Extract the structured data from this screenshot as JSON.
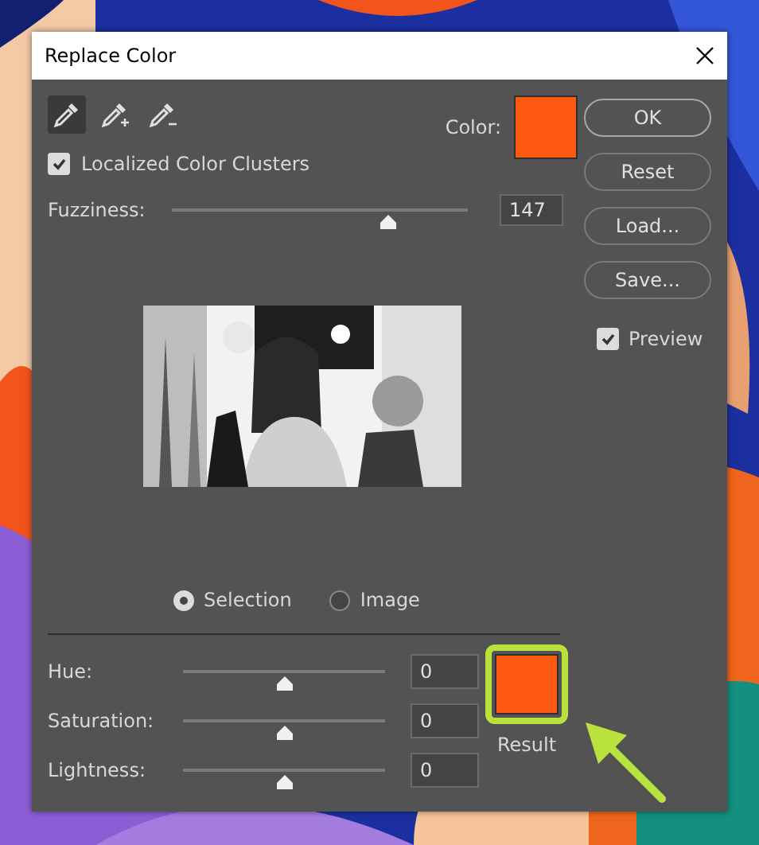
{
  "window": {
    "title": "Replace Color"
  },
  "tools": [
    {
      "kind": "eyedropper",
      "selected": true
    },
    {
      "kind": "eyedropper-plus",
      "selected": false
    },
    {
      "kind": "eyedropper-minus",
      "selected": false
    }
  ],
  "color_swatch": {
    "label": "Color:",
    "color": "#fe5a12"
  },
  "localized_clusters": {
    "label": "Localized Color Clusters",
    "checked": true
  },
  "fuzziness": {
    "label": "Fuzziness:",
    "level": 0.73,
    "value": "147"
  },
  "preview_mode": [
    {
      "label": "Selection",
      "selected": true
    },
    {
      "label": "Image",
      "selected": false
    }
  ],
  "adjustments": [
    {
      "label": "Hue:",
      "level": 0.5,
      "value": "0"
    },
    {
      "label": "Saturation:",
      "level": 0.5,
      "value": "0"
    },
    {
      "label": "Lightness:",
      "level": 0.5,
      "value": "0"
    }
  ],
  "result": {
    "label": "Result",
    "color": "#fe5a12"
  },
  "buttons": [
    {
      "label": "OK",
      "default": true
    },
    {
      "label": "Reset",
      "default": false
    },
    {
      "label": "Load...",
      "default": false
    },
    {
      "label": "Save...",
      "default": false
    }
  ],
  "preview": {
    "label": "Preview",
    "checked": true
  }
}
